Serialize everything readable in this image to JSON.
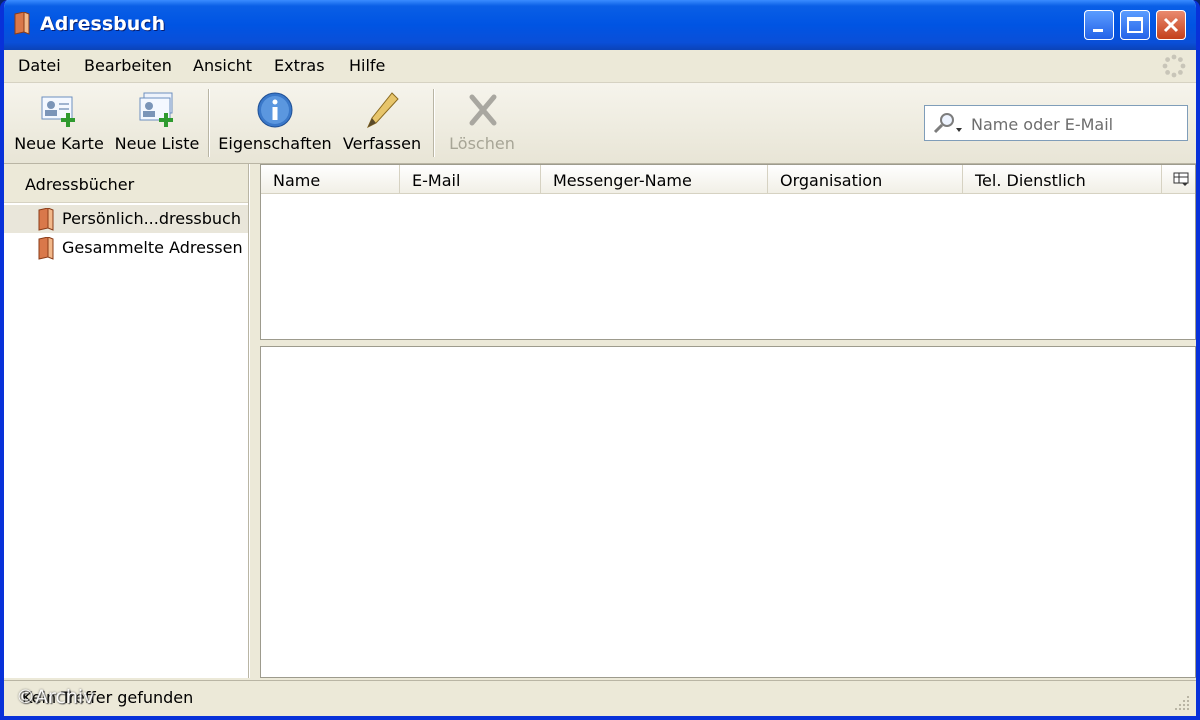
{
  "window": {
    "title": "Adressbuch"
  },
  "menu": [
    "Datei",
    "Bearbeiten",
    "Ansicht",
    "Extras",
    "Hilfe"
  ],
  "toolbar": {
    "new_card": "Neue Karte",
    "new_list": "Neue Liste",
    "properties": "Eigenschaften",
    "compose": "Verfassen",
    "delete": "Löschen"
  },
  "search": {
    "placeholder": "Name oder E-Mail",
    "value": ""
  },
  "sidebar": {
    "header": "Adressbücher",
    "items": [
      {
        "label": "Persönlich...dressbuch",
        "selected": true
      },
      {
        "label": "Gesammelte Adressen",
        "selected": false
      }
    ]
  },
  "table": {
    "columns": [
      "Name",
      "E-Mail",
      "Messenger-Name",
      "Organisation",
      "Tel. Dienstlich"
    ]
  },
  "status": {
    "text": "Kein Treffer gefunden",
    "watermark": "©Archiv"
  },
  "colors": {
    "titlebar": "#0054e3",
    "window_bg": "#ece9d8",
    "close_button": "#c4401b"
  },
  "icons": [
    "book-icon",
    "new-card-icon",
    "new-list-icon",
    "info-icon",
    "pencil-icon",
    "delete-x-icon",
    "magnifier-icon",
    "throbber-icon",
    "column-picker-icon"
  ]
}
